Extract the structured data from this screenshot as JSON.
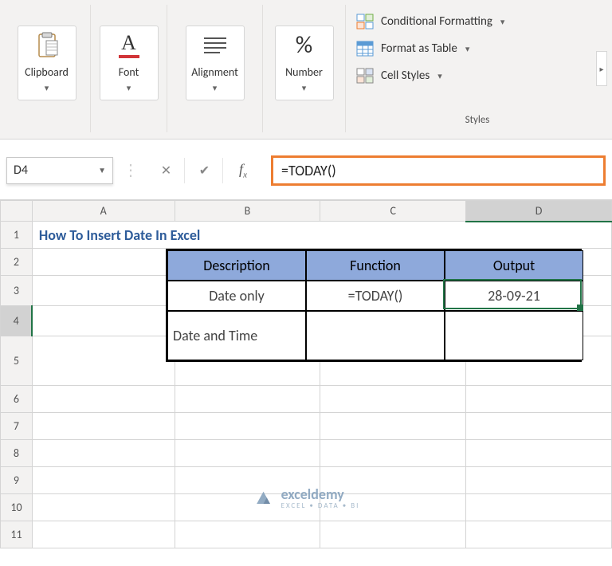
{
  "ribbon": {
    "clipboard_label": "Clipboard",
    "font_label": "Font",
    "alignment_label": "Alignment",
    "number_label": "Number",
    "number_glyph": "%",
    "font_glyph": "A",
    "styles_label": "Styles",
    "cond_fmt": "Conditional Formatting",
    "fmt_table": "Format as Table",
    "cell_styles": "Cell Styles"
  },
  "formula_bar": {
    "name_box": "D4",
    "formula": "=TODAY()"
  },
  "columns": [
    "A",
    "B",
    "C",
    "D"
  ],
  "rows": [
    "1",
    "2",
    "3",
    "4",
    "5",
    "6",
    "7",
    "8",
    "9",
    "10",
    "11"
  ],
  "selected_col_index": 3,
  "selected_row_index": 3,
  "sheet": {
    "title": "How To Insert Date In Excel",
    "headers": [
      "Description",
      "Function",
      "Output"
    ],
    "rows": [
      {
        "desc": "Date only",
        "func": "=TODAY()",
        "out": "28-09-21"
      },
      {
        "desc": "Date and Time",
        "func": "",
        "out": ""
      }
    ]
  },
  "watermark": {
    "brand": "exceldemy",
    "tag": "EXCEL • DATA • BI"
  },
  "chart_data": {
    "type": "table",
    "title": "How To Insert Date In Excel",
    "columns": [
      "Description",
      "Function",
      "Output"
    ],
    "rows": [
      [
        "Date only",
        "=TODAY()",
        "28-09-21"
      ],
      [
        "Date and Time",
        "",
        ""
      ]
    ]
  }
}
